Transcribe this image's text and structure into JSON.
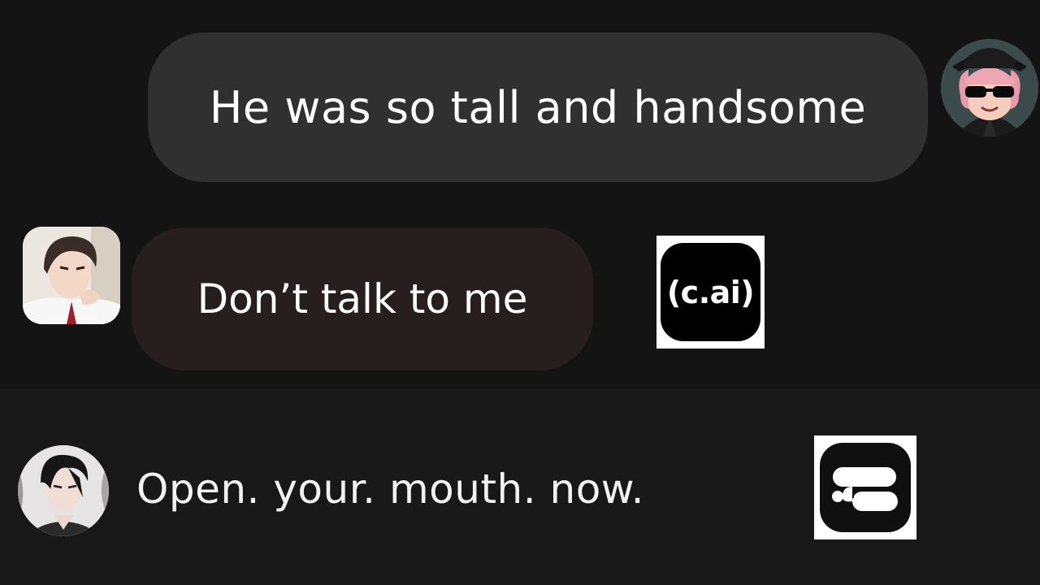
{
  "messages": [
    {
      "sender": "user",
      "text": "He was so tall and handsome"
    },
    {
      "sender": "bot",
      "text": "Don’t talk to me"
    },
    {
      "sender": "bot",
      "text": "Open. your. mouth. now."
    }
  ],
  "logos": {
    "cai": {
      "text": "(c.ai)"
    },
    "talkie": {
      "icon": "talkie-app-icon"
    }
  },
  "colors": {
    "background": "#141414",
    "user_bubble": "#303030",
    "bot_bubble": "#271f1f",
    "text": "#ffffff"
  }
}
